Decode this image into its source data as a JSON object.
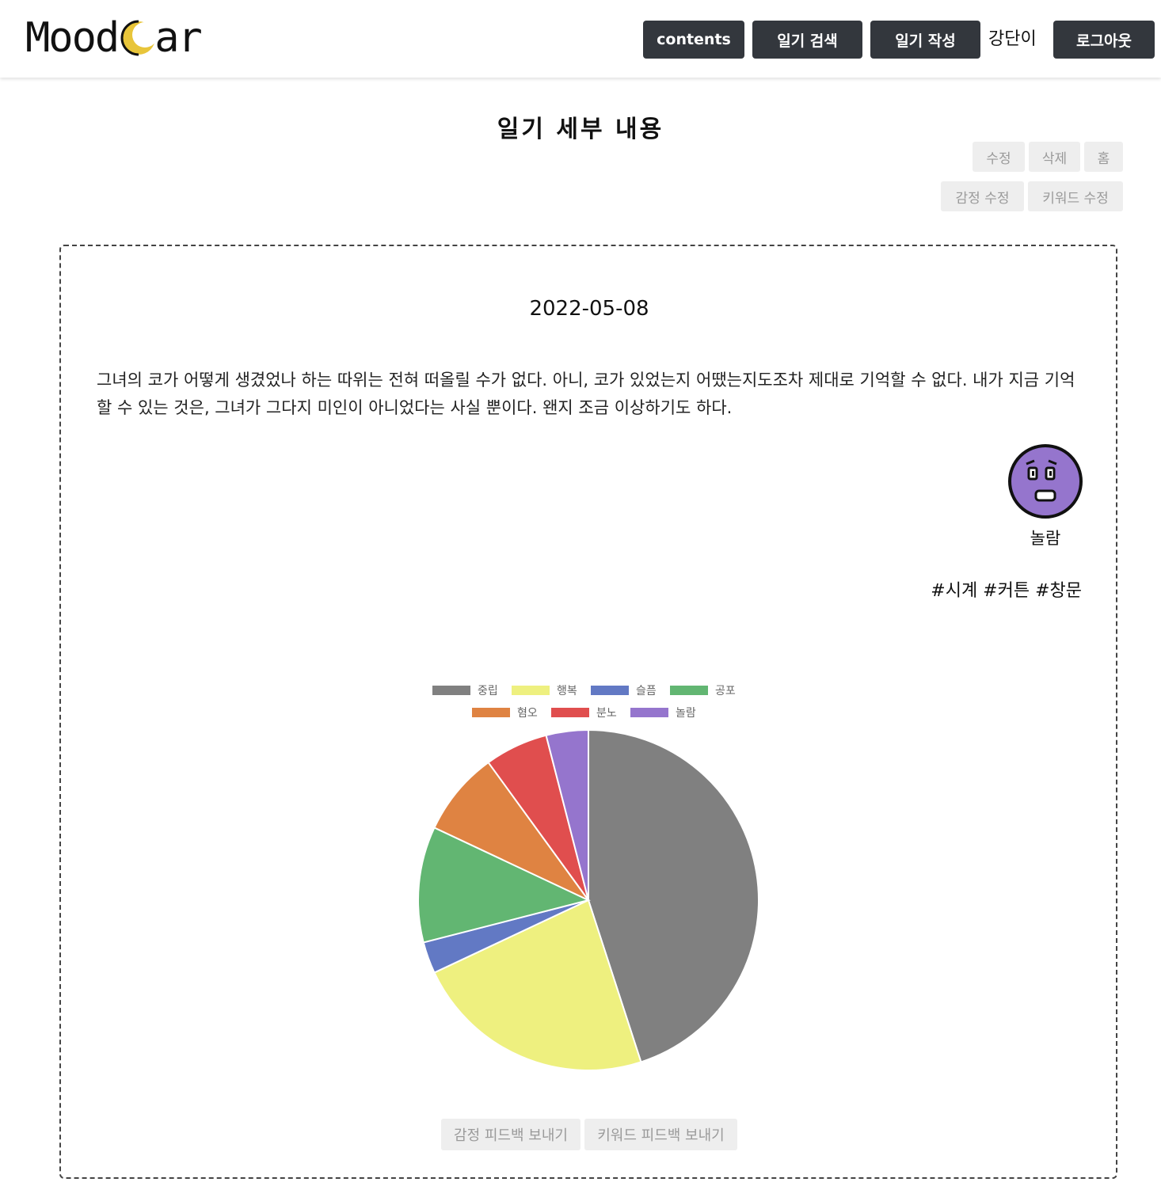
{
  "header": {
    "logo_text_left": "Mood",
    "logo_text_right": "ar",
    "nav": {
      "contents": "contents",
      "search": "일기 검색",
      "write": "일기 작성",
      "user": "강단이",
      "logout": "로그아웃"
    }
  },
  "page": {
    "title": "일기 세부 내용",
    "actions": {
      "edit": "수정",
      "delete": "삭제",
      "home": "홈",
      "edit_emotion": "감정 수정",
      "edit_keyword": "키워드 수정"
    }
  },
  "diary": {
    "date": "2022-05-08",
    "text": "그녀의 코가 어떻게 생겼었나 하는 따위는 전혀 떠올릴 수가 없다. 아니, 코가 있었는지 어땠는지도조차 제대로 기억할 수 없다. 내가 지금 기억할 수 있는 것은, 그녀가 그다지 미인이 아니었다는 사실 뿐이다. 왠지 조금 이상하기도 하다.",
    "emotion": "놀람",
    "emotion_icon": "surprised-face-icon",
    "emotion_color": "#9575cd",
    "keywords": "#시계 #커튼 #창문"
  },
  "chart_data": {
    "type": "pie",
    "categories": [
      "중립",
      "행복",
      "슬픔",
      "공포",
      "혐오",
      "분노",
      "놀람"
    ],
    "values": [
      45,
      23,
      3,
      11,
      8,
      6,
      4
    ],
    "colors": [
      "#808080",
      "#eef07f",
      "#6279c4",
      "#62b672",
      "#df8342",
      "#e04e4e",
      "#9575cd"
    ],
    "legend_position": "top"
  },
  "feedback": {
    "emotion": "감정 피드백 보내기",
    "keyword": "키워드 피드백 보내기"
  }
}
